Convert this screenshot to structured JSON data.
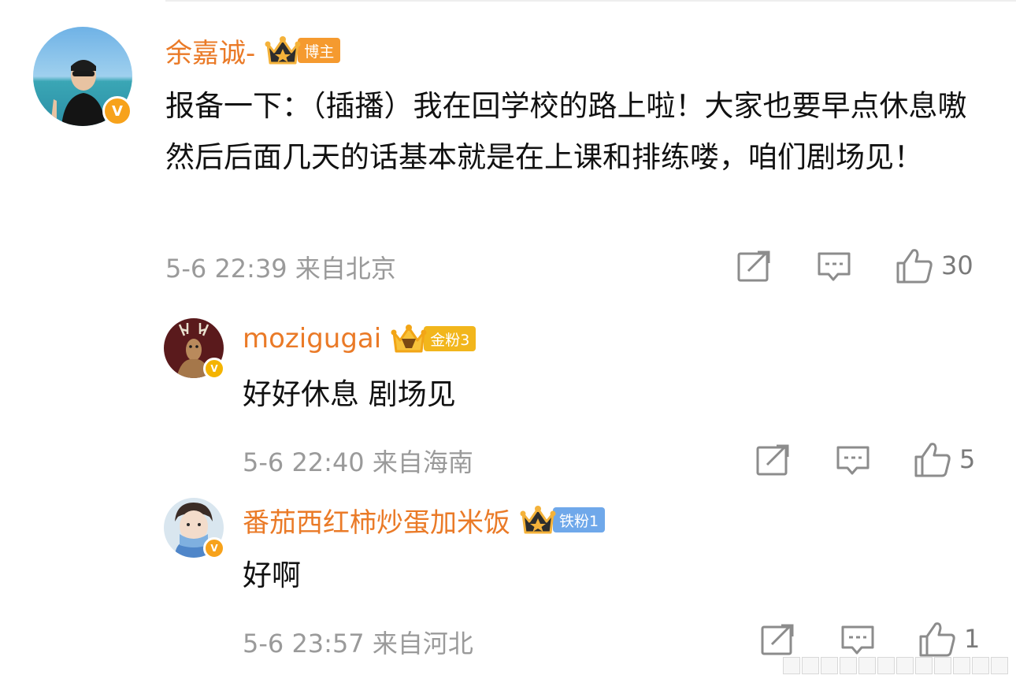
{
  "comments": [
    {
      "author": "余嘉诚-",
      "badge": "博主",
      "badge_color": "#f59a2f",
      "text": "报备一下：（插播）我在回学校的路上啦！大家也要早点休息嗷 然后后面几天的话基本就是在上课和排练喽，咱们剧场见！",
      "meta": "5-6 22:39 来自北京",
      "likes": "30"
    },
    {
      "author": "mozigugai",
      "badge": "金粉3",
      "badge_color": "#f2b61c",
      "text": "好好休息 剧场见",
      "meta": "5-6 22:40 来自海南",
      "likes": "5"
    },
    {
      "author": "番茄西红柿炒蛋加米饭",
      "badge": "铁粉1",
      "badge_color": "#6fa8ea",
      "text": "好啊",
      "meta": "5-6 23:57 来自河北",
      "likes": "1"
    }
  ],
  "icons": {
    "repost": "share-icon",
    "comment": "comment-icon",
    "like": "thumbs-up-icon",
    "verified": "verified-v-icon"
  },
  "colors": {
    "name": "#ea7a27",
    "text": "#111111",
    "meta": "#9a9a9a",
    "verified": "#f7a21b"
  }
}
